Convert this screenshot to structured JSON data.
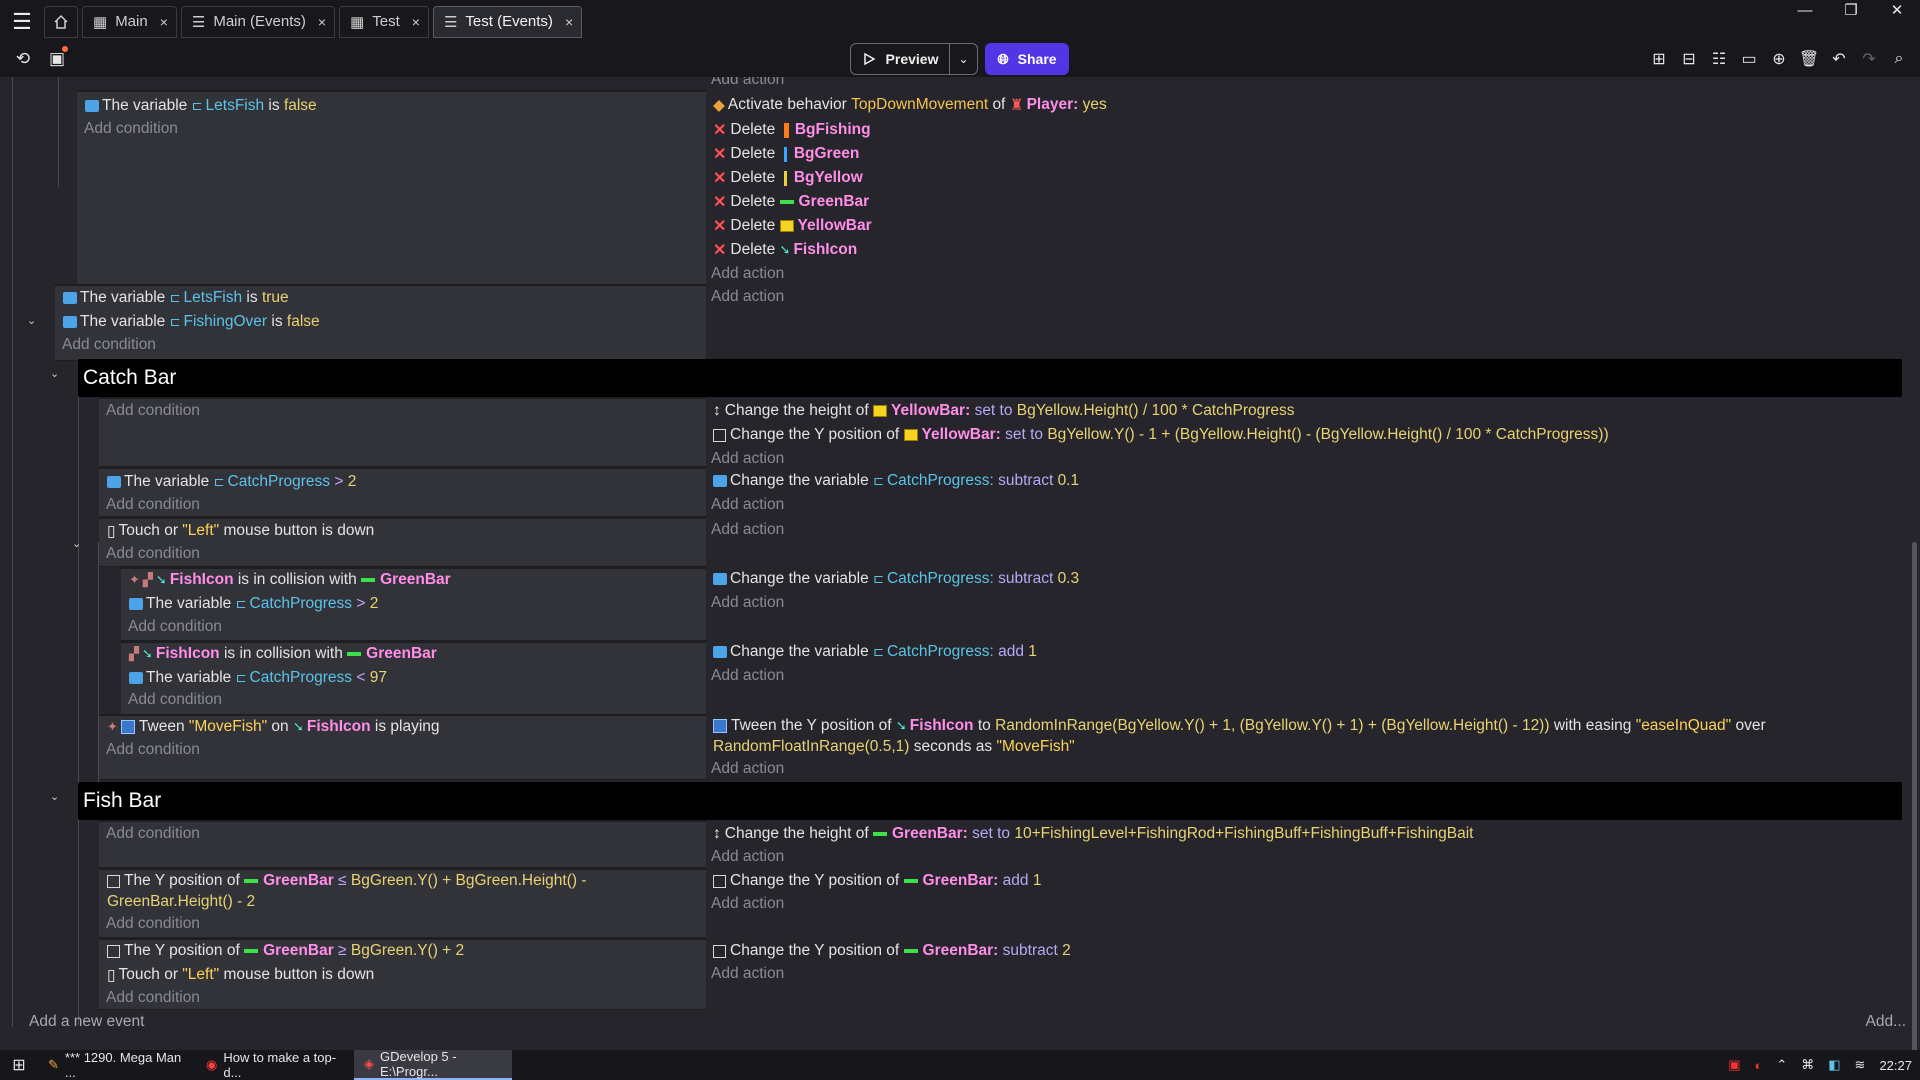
{
  "tabs": {
    "items": [
      {
        "label": "Main",
        "icon": "scene-icon"
      },
      {
        "label": "Main (Events)",
        "icon": "events-icon"
      },
      {
        "label": "Test",
        "icon": "scene-icon"
      },
      {
        "label": "Test (Events)",
        "icon": "events-icon"
      }
    ],
    "close": "×"
  },
  "window": {
    "minimize": "—",
    "maximize": "❐",
    "close": "✕"
  },
  "toolbar": {
    "preview_label": "Preview",
    "share_label": "Share",
    "share_color": "#5236e6"
  },
  "ev1": {
    "cond": {
      "pre": "The variable",
      "var": "LetsFish",
      "mid": "is",
      "val": "false",
      "add": "Add condition"
    },
    "actions": {
      "activate": {
        "pre": "Activate behavior",
        "behavior": "TopDownMovement",
        "of": "of",
        "obj": "Player",
        "colon": ":",
        "val": "yes"
      },
      "deletes": {
        "word": "Delete",
        "o1": "BgFishing",
        "o2": "BgGreen",
        "o3": "BgYellow",
        "o4": "GreenBar",
        "o5": "YellowBar",
        "o6": "FishIcon"
      },
      "add": "Add action",
      "top_add": "Add action"
    }
  },
  "ev2": {
    "c1": {
      "pre": "The variable",
      "var": "LetsFish",
      "mid": "is",
      "val": "true"
    },
    "c2": {
      "pre": "The variable",
      "var": "FishingOver",
      "mid": "is",
      "val": "false"
    },
    "add": "Add condition",
    "add_action": "Add action"
  },
  "groups": {
    "catch_bar": "Catch Bar",
    "fish_bar": "Fish Bar"
  },
  "cb1": {
    "add_cond": "Add condition",
    "a1": {
      "pre": "Change the height of",
      "obj": "YellowBar",
      "colon": ":",
      "op": "set to",
      "expr": "BgYellow.Height() / 100 * CatchProgress"
    },
    "a2": {
      "pre": "Change the Y position of",
      "obj": "YellowBar",
      "colon": ":",
      "op": "set to",
      "expr": "BgYellow.Y() - 1 + (BgYellow.Height() - (BgYellow.Height() / 100 * CatchProgress))"
    },
    "add_action": "Add action"
  },
  "cb2": {
    "cond": {
      "pre": "The variable",
      "var": "CatchProgress",
      "op": ">",
      "val": "2"
    },
    "add_cond": "Add condition",
    "act": {
      "pre": "Change the variable",
      "var": "CatchProgress",
      "colon": ":",
      "op": "subtract",
      "val": "0.1"
    },
    "add_action": "Add action"
  },
  "cb3": {
    "cond": {
      "pre": "Touch or",
      "btn": "\"Left\"",
      "post": "mouse button is down"
    },
    "add_cond": "Add condition",
    "add_action": "Add action"
  },
  "cb3a": {
    "c1": {
      "obj": "FishIcon",
      "mid": "is in collision with",
      "obj2": "GreenBar"
    },
    "c2": {
      "pre": "The variable",
      "var": "CatchProgress",
      "op": ">",
      "val": "2"
    },
    "add_cond": "Add condition",
    "act": {
      "pre": "Change the variable",
      "var": "CatchProgress",
      "colon": ":",
      "op": "subtract",
      "val": "0.3"
    },
    "add_action": "Add action"
  },
  "cb3b": {
    "c1": {
      "obj": "FishIcon",
      "mid": "is in collision with",
      "obj2": "GreenBar"
    },
    "c2": {
      "pre": "The variable",
      "var": "CatchProgress",
      "op": "<",
      "val": "97"
    },
    "add_cond": "Add condition",
    "act": {
      "pre": "Change the variable",
      "var": "CatchProgress",
      "colon": ":",
      "op": "add",
      "val": "1"
    },
    "add_action": "Add action"
  },
  "cb4": {
    "cond": {
      "pre": "Tween",
      "name": "\"MoveFish\"",
      "on": "on",
      "obj": "FishIcon",
      "post": "is playing"
    },
    "add_cond": "Add condition",
    "act": {
      "pre": "Tween the Y position of",
      "obj": "FishIcon",
      "to": "to",
      "expr": "RandomInRange(BgYellow.Y() + 1, (BgYellow.Y() + 1) + (BgYellow.Height() - 12))",
      "easing_pre": "with easing",
      "easing": "\"easeInQuad\"",
      "over": "over",
      "dur": "RandomFloatInRange(0.5,1)",
      "secs": "seconds as",
      "as": "\"MoveFish\""
    },
    "add_action": "Add action"
  },
  "fb1": {
    "add_cond": "Add condition",
    "act": {
      "pre": "Change the height of",
      "obj": "GreenBar",
      "colon": ":",
      "op": "set to",
      "expr": "10+FishingLevel+FishingRod+FishingBuff+FishingBuff+FishingBait"
    },
    "add_action": "Add action"
  },
  "fb2": {
    "cond": {
      "pre": "The Y position of",
      "obj": "GreenBar",
      "op": "≤",
      "expr": "BgGreen.Y() + BgGreen.Height() -",
      "expr2": "GreenBar.Height() - 2"
    },
    "add_cond": "Add condition",
    "act": {
      "pre": "Change the Y position of",
      "obj": "GreenBar",
      "colon": ":",
      "op": "add",
      "val": "1"
    },
    "add_action": "Add action"
  },
  "fb3": {
    "c1": {
      "pre": "The Y position of",
      "obj": "GreenBar",
      "op": "≥",
      "expr": "BgGreen.Y() + 2"
    },
    "c2": {
      "pre": "Touch or",
      "btn": "\"Left\"",
      "post": "mouse button is down"
    },
    "add_cond": "Add condition",
    "act": {
      "pre": "Change the Y position of",
      "obj": "GreenBar",
      "colon": ":",
      "op": "subtract",
      "val": "2"
    },
    "add_action": "Add action"
  },
  "footer": {
    "add_new_event": "Add a new event",
    "add_more": "Add..."
  },
  "taskbar": {
    "items": [
      "*** 1290. Mega Man ...",
      "How to make a top-d...",
      "GDevelop 5 - E:\\Progr..."
    ],
    "time": "22:27"
  }
}
